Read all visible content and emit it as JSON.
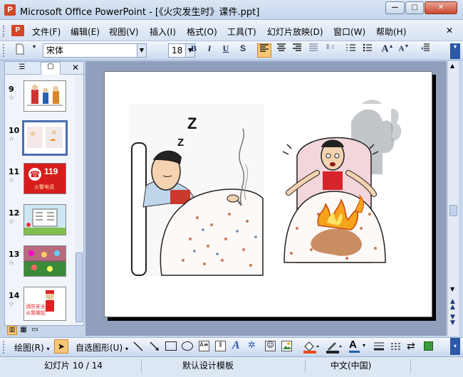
{
  "window": {
    "title": "Microsoft Office PowerPoint - [《火灾发生时》课件.ppt]"
  },
  "menu": {
    "items": [
      "文件(F)",
      "编辑(E)",
      "视图(V)",
      "插入(I)",
      "格式(O)",
      "工具(T)",
      "幻灯片放映(D)",
      "窗口(W)",
      "帮助(H)"
    ]
  },
  "format_toolbar": {
    "font": "宋体",
    "size": "18"
  },
  "slides": [
    {
      "number": "9"
    },
    {
      "number": "10"
    },
    {
      "number": "11",
      "text1": "119",
      "text2": "火警电话"
    },
    {
      "number": "12"
    },
    {
      "number": "13"
    },
    {
      "number": "14",
      "text1": "消防安全",
      "text2": "从我做起"
    }
  ],
  "draw_toolbar": {
    "draw_label": "绘图(R)",
    "autoshape_label": "自选图形(U)"
  },
  "status": {
    "slide": "幻灯片 10 / 14",
    "template": "默认设计模板",
    "language": "中文(中国)"
  },
  "colors": {
    "accent": "#d24726",
    "selected_thumb_border": "#4a6eb0"
  }
}
